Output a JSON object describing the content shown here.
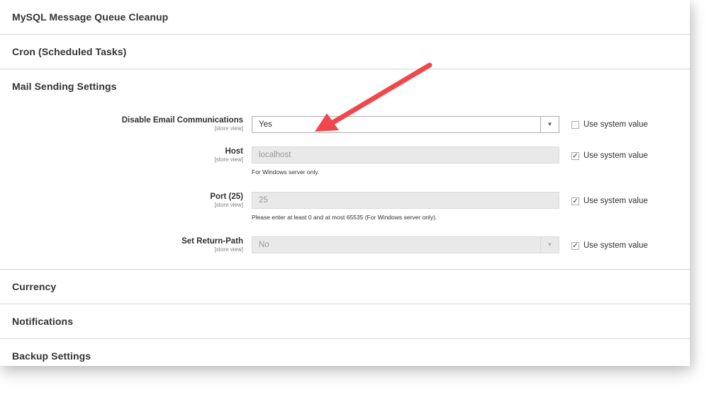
{
  "sections": {
    "mysql_queue": "MySQL Message Queue Cleanup",
    "cron": "Cron (Scheduled Tasks)",
    "mail": "Mail Sending Settings",
    "currency": "Currency",
    "notifications": "Notifications",
    "backup": "Backup Settings"
  },
  "fields": {
    "disable_email": {
      "label": "Disable Email Communications",
      "scope": "[store view]",
      "value": "Yes",
      "use_system_value": false,
      "use_system_label": "Use system value"
    },
    "host": {
      "label": "Host",
      "scope": "[store view]",
      "value": "localhost",
      "note": "For Windows server only.",
      "use_system_value": true,
      "use_system_label": "Use system value"
    },
    "port": {
      "label": "Port (25)",
      "scope": "[store view]",
      "value": "25",
      "note": "Please enter at least 0 and at most 65535 (For Windows server only).",
      "use_system_value": true,
      "use_system_label": "Use system value"
    },
    "return_path": {
      "label": "Set Return-Path",
      "scope": "[store view]",
      "value": "No",
      "use_system_value": true,
      "use_system_label": "Use system value"
    }
  },
  "icons": {
    "dropdown": "▼",
    "check": "✓"
  },
  "colors": {
    "annotation_arrow": "#f0474c",
    "section_border": "#d6d6d6",
    "disabled_bg": "#e9e9e9"
  }
}
